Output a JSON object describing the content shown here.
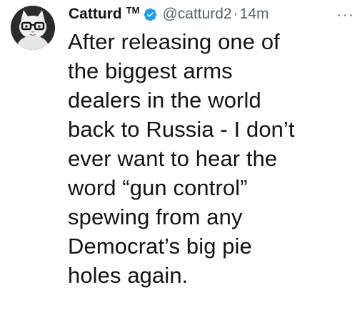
{
  "tweet": {
    "author": {
      "display_name": "Catturd",
      "trademark": "TM",
      "handle": "@catturd2",
      "verified_icon": "verified-badge-icon",
      "verified_color": "#1d9bf0",
      "avatar_icon": "cat-with-glasses-avatar"
    },
    "separator": "·",
    "timestamp": "14m",
    "more_icon": "more-options-icon",
    "text": "After releasing one of\nthe biggest arms\ndealers in the world\nback to Russia - I don’t\never want to hear the\nword “gun control”\nspewing from any\nDemocrat’s big pie\nholes again."
  }
}
